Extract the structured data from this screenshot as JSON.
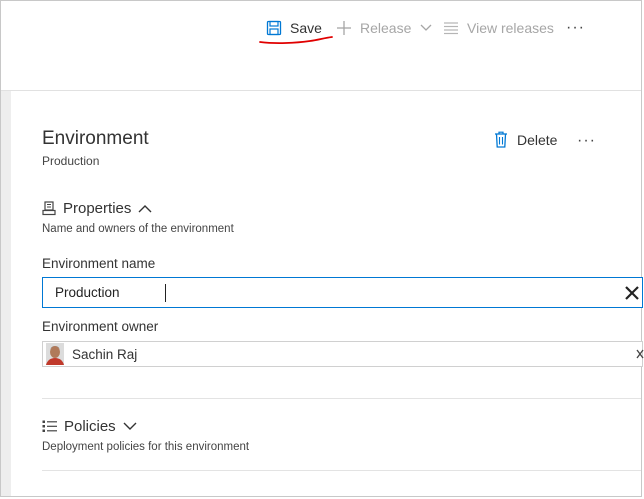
{
  "toolbar": {
    "save_label": "Save",
    "release_label": "Release",
    "view_releases_label": "View releases",
    "more_label": "···"
  },
  "icons": {
    "save": "save-icon",
    "release": "plus-icon",
    "view_releases": "list-icon",
    "delete": "trash-icon",
    "properties": "properties-icon",
    "policies": "policies-icon"
  },
  "environment": {
    "title": "Environment",
    "subtitle": "Production",
    "delete_label": "Delete",
    "more_label": "···"
  },
  "properties": {
    "heading": "Properties",
    "description": "Name and owners of the environment",
    "name_label": "Environment name",
    "name_value": "Production",
    "owner_label": "Environment owner",
    "owner_name": "Sachin Raj"
  },
  "policies": {
    "heading": "Policies",
    "description": "Deployment policies for this environment"
  },
  "colors": {
    "accent": "#0078d4",
    "annotation_underline": "#e00000",
    "disabled_text": "#a6a6a6"
  }
}
